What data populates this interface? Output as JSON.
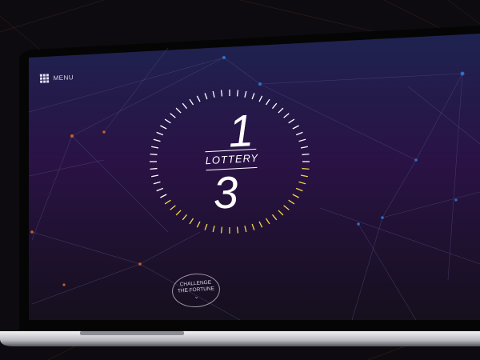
{
  "menu": {
    "label": "MENU",
    "icon": "grid-icon"
  },
  "lottery": {
    "top_number": "1",
    "title": "LOTTERY",
    "bottom_number": "3"
  },
  "challenge": {
    "line1": "CHALLENGE",
    "line2": "THE FORTUNE",
    "icon": "chevron-down-icon"
  },
  "colors": {
    "screen_top": "#1e2350",
    "screen_mid": "#2a1245",
    "screen_bottom": "#15101d",
    "tick_white": "#ffffff",
    "tick_yellow": "#f2d64b",
    "node_blue": "#2f6fc4",
    "node_orange": "#c4602a"
  }
}
